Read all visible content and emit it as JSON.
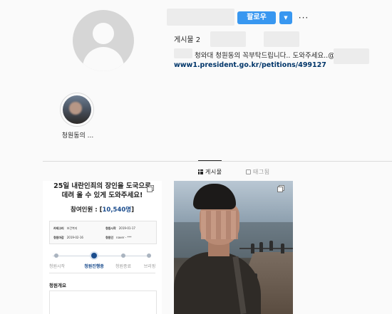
{
  "profile": {
    "follow_label": "팔로우",
    "dropdown_glyph": "▼",
    "more_glyph": "···",
    "posts_count_label": "게시물 2",
    "bio_text": "청와대 청원동의 꼭부탁드립니다.. 도와주세요..@",
    "bio_link": "www1.president.go.kr/petitions/499127",
    "accent_color": "#3897f0"
  },
  "highlight": {
    "label": "청원동의 ..."
  },
  "tabs": [
    {
      "label": "게시물",
      "icon": "grid-icon",
      "active": true
    },
    {
      "label": "태그됨",
      "icon": "tag-icon",
      "active": false
    }
  ],
  "post1": {
    "title_line1": "25일 내란인죄의 장인을 도국으로",
    "title_line2": "데려 올 수 있게 도와주세요!",
    "count_prefix": "참여인원 : [",
    "count_value": "10,540명",
    "count_suffix": "]",
    "table": {
      "category_key": "카테고리",
      "category_val": "보건복지",
      "start_key": "청원시작",
      "start_val": "2019-01-17",
      "end_key": "청원마감",
      "end_val": "2019-02-16",
      "author_key": "청원인",
      "author_val": "naver - ***"
    },
    "steps": [
      "청원시작",
      "청원진행중",
      "청원종료",
      "브리핑"
    ],
    "active_step": 1,
    "overview_label": "청원개요"
  }
}
